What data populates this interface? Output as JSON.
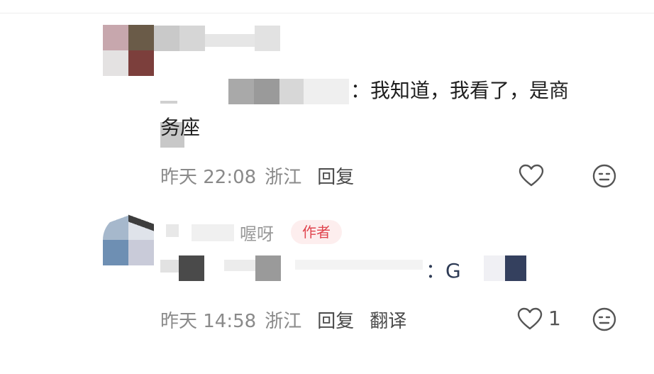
{
  "comments": [
    {
      "body_text_line1_suffix": "：我知道，我看了，是商",
      "body_text_line2": "务座",
      "time": "昨天 22:08",
      "location": "浙江",
      "reply_label": "回复",
      "icons": {
        "like": "heart-icon",
        "more": "emoji-icon"
      }
    },
    {
      "username_visible": "喔呀",
      "author_badge": "作者",
      "body_visible_suffix": "：G",
      "time": "昨天 14:58",
      "location": "浙江",
      "reply_label": "回复",
      "translate_label": "翻译",
      "like_count": "1",
      "icons": {
        "like": "heart-icon",
        "more": "emoji-icon"
      }
    }
  ],
  "colors": {
    "author_badge_bg": "#fdeeee",
    "author_badge_text": "#e0444e",
    "meta_text": "#8a8a8a"
  }
}
